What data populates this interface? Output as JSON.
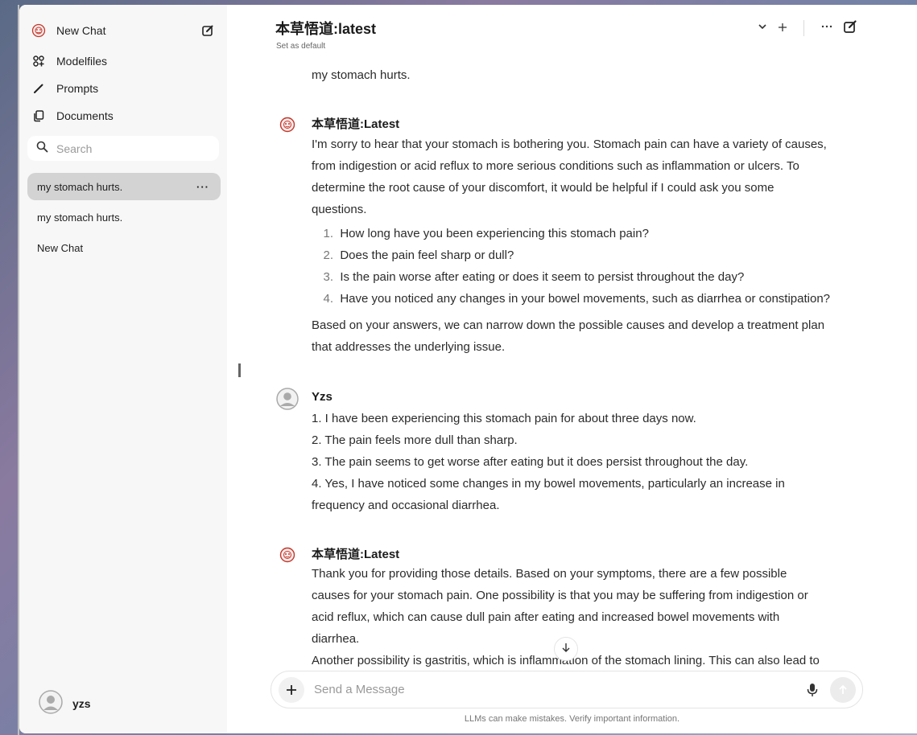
{
  "sidebar": {
    "new_chat": "New Chat",
    "nav": {
      "modelfiles": "Modelfiles",
      "prompts": "Prompts",
      "documents": "Documents"
    },
    "search_placeholder": "Search",
    "chats": [
      {
        "title": "my stomach hurts.",
        "active": true,
        "more": "···"
      },
      {
        "title": "my stomach hurts.",
        "active": false
      },
      {
        "title": "New Chat",
        "active": false
      }
    ],
    "user": "yzs"
  },
  "header": {
    "model": "本草悟道:latest",
    "set_default": "Set as default"
  },
  "messages": {
    "user_prev": "my stomach hurts.",
    "bot1": {
      "author": "本草悟道:Latest",
      "intro": [
        "I'm sorry to hear that your stomach is bothering you. Stomach pain can have a variety of causes,",
        "from indigestion or acid reflux to more serious conditions such as inflammation or ulcers. To",
        "determine the root cause of your discomfort, it would be helpful if I could ask you some",
        "questions."
      ],
      "questions": [
        "How long have you been experiencing this stomach pain?",
        "Does the pain feel sharp or dull?",
        "Is the pain worse after eating or does it seem to persist throughout the day?",
        "Have you noticed any changes in your bowel movements, such as diarrhea or constipation?"
      ],
      "outro": [
        "Based on your answers, we can narrow down the possible causes and develop a treatment plan",
        "that addresses the underlying issue."
      ]
    },
    "user": {
      "author": "Yzs",
      "lines": [
        "1. I have been experiencing this stomach pain for about three days now.",
        "2. The pain feels more dull than sharp.",
        "3. The pain seems to get worse after eating but it does persist throughout the day.",
        "4. Yes, I have noticed some changes in my bowel movements, particularly an increase in",
        "frequency and occasional diarrhea."
      ]
    },
    "bot2": {
      "author": "本草悟道:Latest",
      "lines": [
        "Thank you for providing those details. Based on your symptoms, there are a few possible",
        "causes for your stomach pain. One possibility is that you may be suffering from indigestion or",
        "acid reflux, which can cause dull pain after eating and increased bowel movements with",
        "diarrhea.",
        "Another possibility is gastritis, which is inflammation of the stomach lining. This can also lead to"
      ]
    }
  },
  "composer": {
    "placeholder": "Send a Message",
    "disclaimer": "LLMs can make mistakes. Verify important information."
  },
  "colors": {
    "sidebar_bg": "#f7f7f7",
    "active_chat_bg": "#d3d3d3",
    "bot_avatar": "#c0392b"
  }
}
